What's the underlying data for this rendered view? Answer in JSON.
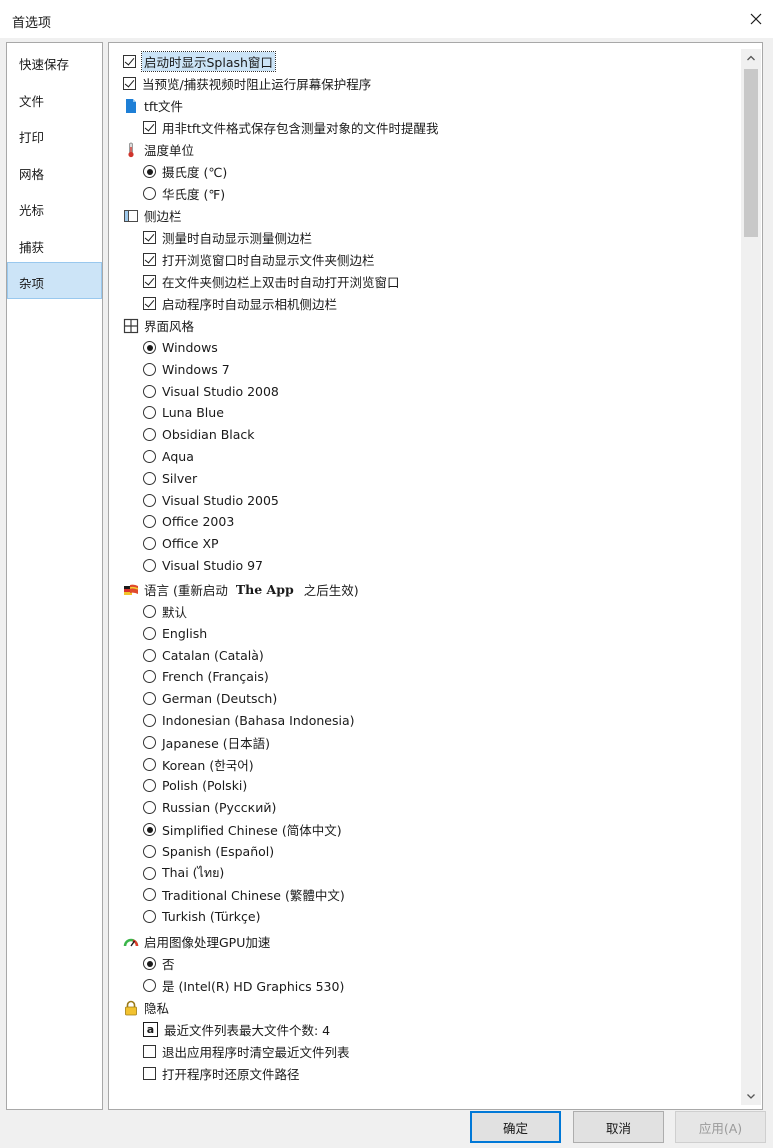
{
  "window": {
    "title": "首选项"
  },
  "nav": {
    "items": [
      {
        "label": "快速保存"
      },
      {
        "label": "文件"
      },
      {
        "label": "打印"
      },
      {
        "label": "网格"
      },
      {
        "label": "光标"
      },
      {
        "label": "捕获"
      },
      {
        "label": "杂项"
      }
    ],
    "selected": "杂项"
  },
  "settings": {
    "show_splash": "启动时显示Splash窗口",
    "block_screensaver": "当预览/捕获视频时阻止运行屏幕保护程序",
    "tft": {
      "header": "tft文件",
      "remind_non_tft": "用非tft文件格式保存包含测量对象的文件时提醒我"
    },
    "temperature": {
      "header": "温度单位",
      "celsius": "摄氏度 (℃)",
      "fahrenheit": "华氏度 (℉)"
    },
    "sidebar": {
      "header": "侧边栏",
      "measure_sidebar": "测量时自动显示测量侧边栏",
      "folder_sidebar": "打开浏览窗口时自动显示文件夹侧边栏",
      "dblclick_browser": "在文件夹侧边栏上双击时自动打开浏览窗口",
      "camera_sidebar": "启动程序时自动显示相机侧边栏"
    },
    "ui_style": {
      "header": "界面风格",
      "options": [
        "Windows",
        "Windows 7",
        "Visual Studio 2008",
        "Luna Blue",
        "Obsidian Black",
        "Aqua",
        "Silver",
        "Visual Studio 2005",
        "Office 2003",
        "Office XP",
        "Visual Studio 97"
      ],
      "selected": "Windows"
    },
    "language": {
      "header_prefix": "语言 (重新启动",
      "app_name": "The App",
      "header_suffix": "之后生效)",
      "options": [
        "默认",
        "English",
        "Catalan (Català)",
        "French (Français)",
        "German (Deutsch)",
        "Indonesian (Bahasa Indonesia)",
        "Japanese (日本語)",
        "Korean (한국어)",
        "Polish (Polski)",
        "Russian (Русский)",
        "Simplified Chinese (简体中文)",
        "Spanish (Español)",
        "Thai (ไทย)",
        "Traditional Chinese (繁體中文)",
        "Turkish (Türkçe)"
      ],
      "selected": "Simplified Chinese (简体中文)"
    },
    "gpu": {
      "header": "启用图像处理GPU加速",
      "no": "否",
      "yes": "是 (Intel(R) HD Graphics 530)"
    },
    "privacy": {
      "header": "隐私",
      "max_recent_badge": "a",
      "max_recent": "最近文件列表最大文件个数: 4",
      "clear_recent": "退出应用程序时清空最近文件列表",
      "restore_path": "打开程序时还原文件路径"
    }
  },
  "buttons": {
    "ok": "确定",
    "cancel": "取消",
    "apply": "应用(A)"
  },
  "colors": {
    "selection": "#cce4f7",
    "accent": "#0078d7",
    "window_bg": "#f0f0f0"
  }
}
